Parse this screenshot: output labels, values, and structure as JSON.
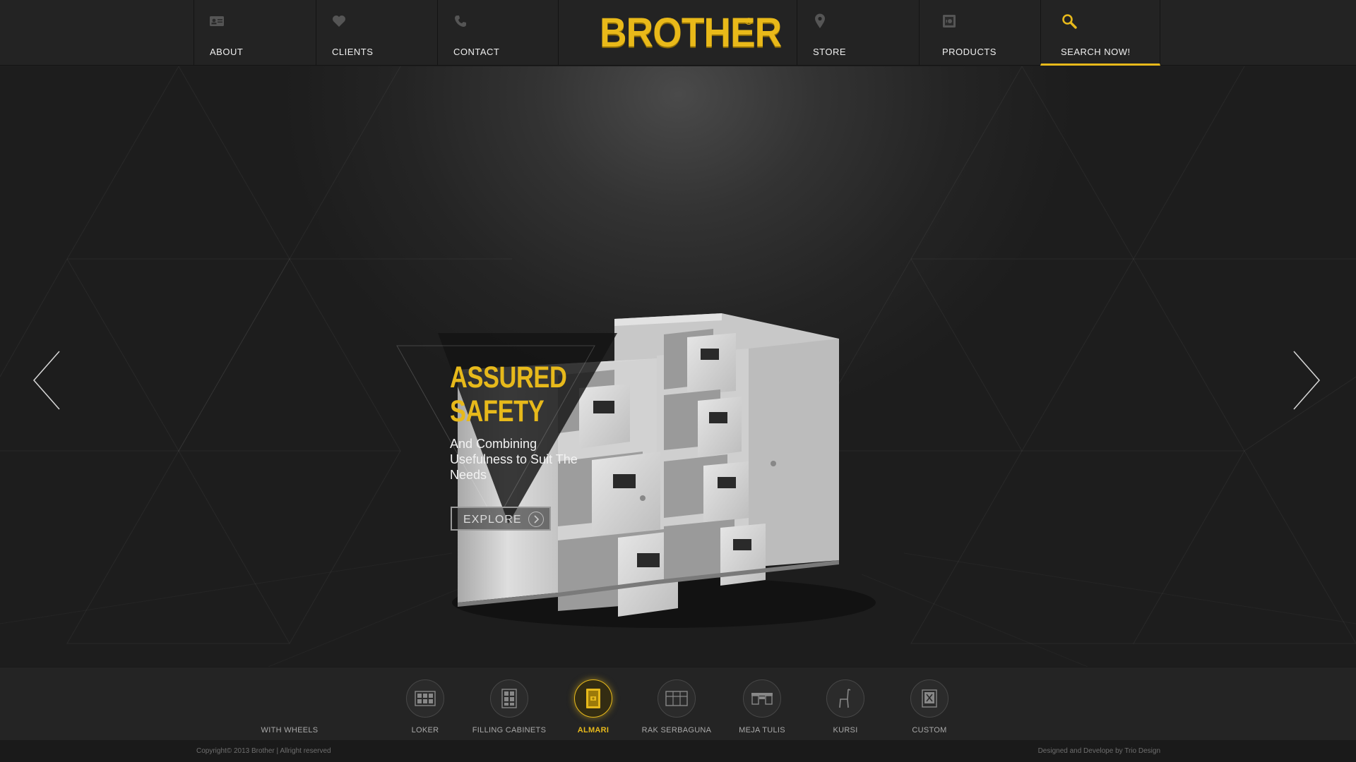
{
  "nav": {
    "left": [
      {
        "label": "ABOUT",
        "icon": "id-card-icon"
      },
      {
        "label": "CLIENTS",
        "icon": "heart-icon"
      },
      {
        "label": "CONTACT",
        "icon": "phone-icon"
      }
    ],
    "brand": "BROTHER",
    "brand_mark": "®",
    "right": [
      {
        "label": "STORE",
        "icon": "map-pin-icon"
      },
      {
        "label": "PRODUCTS",
        "icon": "safe-icon"
      },
      {
        "label": "SEARCH NOW!",
        "icon": "search-icon",
        "active": true
      }
    ]
  },
  "hero": {
    "headline_line1": "ASSURED",
    "headline_line2": "SAFETY",
    "subtitle": "And Combining Usefulness to Suit The Needs",
    "cta_label": "EXPLORE",
    "prev_icon": "chevron-left-icon",
    "next_icon": "chevron-right-icon"
  },
  "categories": [
    {
      "label": "WITH WHEELS",
      "icon": "wheels-icon"
    },
    {
      "label": "LOKER",
      "icon": "locker-icon"
    },
    {
      "label": "FILLING CABINETS",
      "icon": "filing-cabinet-icon"
    },
    {
      "label": "ALMARI",
      "icon": "cupboard-icon",
      "active": true
    },
    {
      "label": "RAK SERBAGUNA",
      "icon": "shelf-icon"
    },
    {
      "label": "MEJA TULIS",
      "icon": "desk-icon"
    },
    {
      "label": "KURSI",
      "icon": "chair-icon"
    },
    {
      "label": "CUSTOM",
      "icon": "custom-icon"
    }
  ],
  "footer": {
    "copyright": "Copyright© 2013 Brother | Allright reserved",
    "credit": "Designed and Develope by Trio Design"
  },
  "colors": {
    "accent": "#e7b91b",
    "background": "#1e1e1e",
    "nav_bg": "#232323"
  }
}
